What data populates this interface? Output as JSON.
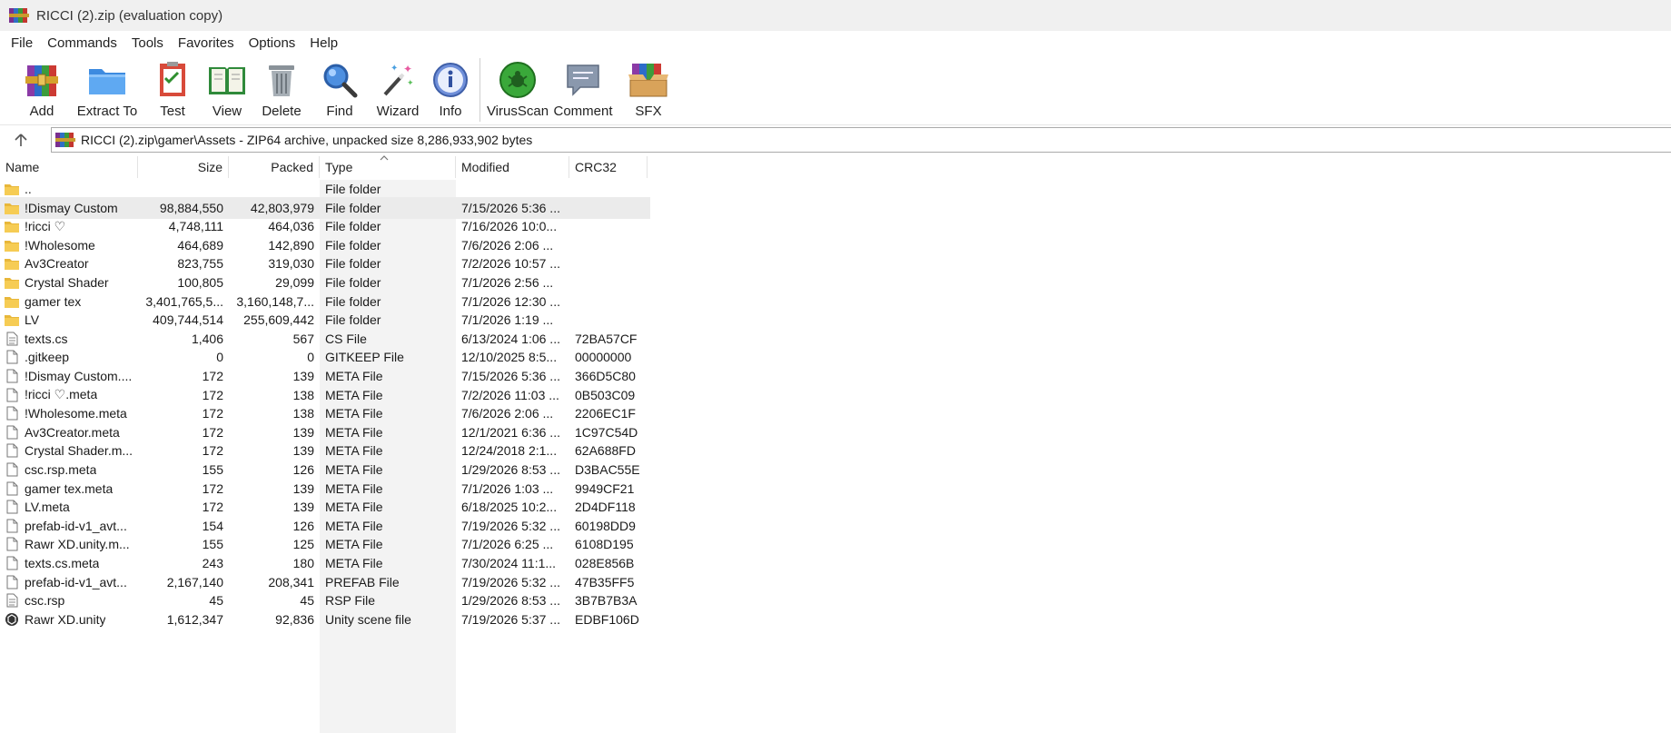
{
  "window": {
    "title": "RICCI (2).zip (evaluation copy)"
  },
  "menu": [
    "File",
    "Commands",
    "Tools",
    "Favorites",
    "Options",
    "Help"
  ],
  "toolbar": [
    {
      "label": "Add",
      "icon": "add-archive-icon"
    },
    {
      "label": "Extract To",
      "icon": "extract-folder-icon"
    },
    {
      "label": "Test",
      "icon": "test-checklist-icon"
    },
    {
      "label": "View",
      "icon": "view-book-icon"
    },
    {
      "label": "Delete",
      "icon": "trash-icon"
    },
    {
      "label": "Find",
      "icon": "magnifier-icon"
    },
    {
      "label": "Wizard",
      "icon": "wizard-wand-icon"
    },
    {
      "label": "Info",
      "icon": "info-icon"
    },
    {
      "label": "VirusScan",
      "icon": "virus-scan-icon"
    },
    {
      "label": "Comment",
      "icon": "comment-icon"
    },
    {
      "label": "SFX",
      "icon": "sfx-box-icon"
    }
  ],
  "address": {
    "path": "RICCI (2).zip\\gamer\\Assets - ZIP64 archive, unpacked size 8,286,933,902 bytes"
  },
  "columns": {
    "name": "Name",
    "size": "Size",
    "packed": "Packed",
    "type": "Type",
    "modified": "Modified",
    "crc": "CRC32"
  },
  "files": [
    {
      "name": "..",
      "size": "",
      "packed": "",
      "type": "File folder",
      "modified": "",
      "crc": "",
      "icon": "folder-icon"
    },
    {
      "name": "!Dismay Custom",
      "size": "98,884,550",
      "packed": "42,803,979",
      "type": "File folder",
      "modified": "7/15/2026 5:36 ...",
      "crc": "",
      "icon": "folder-icon",
      "selected": true
    },
    {
      "name": "!ricci ♡",
      "size": "4,748,111",
      "packed": "464,036",
      "type": "File folder",
      "modified": "7/16/2026 10:0...",
      "crc": "",
      "icon": "folder-icon"
    },
    {
      "name": "!Wholesome",
      "size": "464,689",
      "packed": "142,890",
      "type": "File folder",
      "modified": "7/6/2026 2:06 ...",
      "crc": "",
      "icon": "folder-icon"
    },
    {
      "name": "Av3Creator",
      "size": "823,755",
      "packed": "319,030",
      "type": "File folder",
      "modified": "7/2/2026 10:57 ...",
      "crc": "",
      "icon": "folder-icon"
    },
    {
      "name": "Crystal Shader",
      "size": "100,805",
      "packed": "29,099",
      "type": "File folder",
      "modified": "7/1/2026 2:56 ...",
      "crc": "",
      "icon": "folder-icon"
    },
    {
      "name": "gamer tex",
      "size": "3,401,765,5...",
      "packed": "3,160,148,7...",
      "type": "File folder",
      "modified": "7/1/2026 12:30 ...",
      "crc": "",
      "icon": "folder-icon"
    },
    {
      "name": "LV",
      "size": "409,744,514",
      "packed": "255,609,442",
      "type": "File folder",
      "modified": "7/1/2026 1:19 ...",
      "crc": "",
      "icon": "folder-icon"
    },
    {
      "name": "texts.cs",
      "size": "1,406",
      "packed": "567",
      "type": "CS File",
      "modified": "6/13/2024 1:06 ...",
      "crc": "72BA57CF",
      "icon": "text-file-icon"
    },
    {
      "name": ".gitkeep",
      "size": "0",
      "packed": "0",
      "type": "GITKEEP File",
      "modified": "12/10/2025 8:5...",
      "crc": "00000000",
      "icon": "blank-file-icon"
    },
    {
      "name": "!Dismay Custom....",
      "size": "172",
      "packed": "139",
      "type": "META File",
      "modified": "7/15/2026 5:36 ...",
      "crc": "366D5C80",
      "icon": "blank-file-icon"
    },
    {
      "name": "!ricci ♡.meta",
      "size": "172",
      "packed": "138",
      "type": "META File",
      "modified": "7/2/2026 11:03 ...",
      "crc": "0B503C09",
      "icon": "blank-file-icon"
    },
    {
      "name": "!Wholesome.meta",
      "size": "172",
      "packed": "138",
      "type": "META File",
      "modified": "7/6/2026 2:06 ...",
      "crc": "2206EC1F",
      "icon": "blank-file-icon"
    },
    {
      "name": "Av3Creator.meta",
      "size": "172",
      "packed": "139",
      "type": "META File",
      "modified": "12/1/2021 6:36 ...",
      "crc": "1C97C54D",
      "icon": "blank-file-icon"
    },
    {
      "name": "Crystal Shader.m...",
      "size": "172",
      "packed": "139",
      "type": "META File",
      "modified": "12/24/2018 2:1...",
      "crc": "62A688FD",
      "icon": "blank-file-icon"
    },
    {
      "name": "csc.rsp.meta",
      "size": "155",
      "packed": "126",
      "type": "META File",
      "modified": "1/29/2026 8:53 ...",
      "crc": "D3BAC55E",
      "icon": "blank-file-icon"
    },
    {
      "name": "gamer tex.meta",
      "size": "172",
      "packed": "139",
      "type": "META File",
      "modified": "7/1/2026 1:03 ...",
      "crc": "9949CF21",
      "icon": "blank-file-icon"
    },
    {
      "name": "LV.meta",
      "size": "172",
      "packed": "139",
      "type": "META File",
      "modified": "6/18/2025 10:2...",
      "crc": "2D4DF118",
      "icon": "blank-file-icon"
    },
    {
      "name": "prefab-id-v1_avt...",
      "size": "154",
      "packed": "126",
      "type": "META File",
      "modified": "7/19/2026 5:32 ...",
      "crc": "60198DD9",
      "icon": "blank-file-icon"
    },
    {
      "name": "Rawr XD.unity.m...",
      "size": "155",
      "packed": "125",
      "type": "META File",
      "modified": "7/1/2026 6:25 ...",
      "crc": "6108D195",
      "icon": "blank-file-icon"
    },
    {
      "name": "texts.cs.meta",
      "size": "243",
      "packed": "180",
      "type": "META File",
      "modified": "7/30/2024 11:1...",
      "crc": "028E856B",
      "icon": "blank-file-icon"
    },
    {
      "name": "prefab-id-v1_avt...",
      "size": "2,167,140",
      "packed": "208,341",
      "type": "PREFAB File",
      "modified": "7/19/2026 5:32 ...",
      "crc": "47B35FF5",
      "icon": "blank-file-icon"
    },
    {
      "name": "csc.rsp",
      "size": "45",
      "packed": "45",
      "type": "RSP File",
      "modified": "1/29/2026 8:53 ...",
      "crc": "3B7B7B3A",
      "icon": "text-file-icon"
    },
    {
      "name": "Rawr XD.unity",
      "size": "1,612,347",
      "packed": "92,836",
      "type": "Unity scene file",
      "modified": "7/19/2026 5:37 ...",
      "crc": "EDBF106D",
      "icon": "unity-file-icon"
    }
  ]
}
